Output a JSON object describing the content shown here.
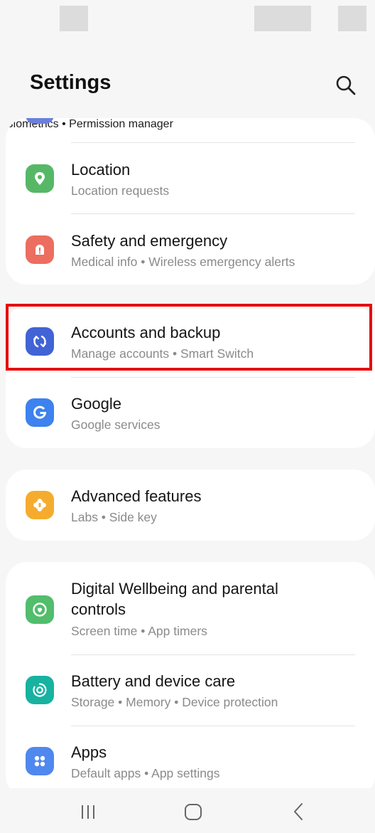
{
  "header": {
    "title": "Settings"
  },
  "items": [
    {
      "title": "Location",
      "subtitle": "Location requests",
      "icon": "location-pin-icon",
      "color": "#56b866"
    },
    {
      "title": "Safety and emergency",
      "subtitle": "Medical info  •  Wireless emergency alerts",
      "icon": "alert-icon",
      "color": "#ec6e60"
    },
    {
      "title": "Accounts and backup",
      "subtitle": "Manage accounts  •  Smart Switch",
      "icon": "sync-icon",
      "color": "#4263d6"
    },
    {
      "title": "Google",
      "subtitle": "Google services",
      "icon": "google-icon",
      "color": "#3d82ee"
    },
    {
      "title": "Advanced features",
      "subtitle": "Labs  •  Side key",
      "icon": "puzzle-icon",
      "color": "#f5ac2e"
    },
    {
      "title_line1": "Digital Wellbeing and parental",
      "title_line2": "controls",
      "subtitle": "Screen time  •  App timers",
      "icon": "wellbeing-icon",
      "color": "#52bd6c"
    },
    {
      "title": "Battery and device care",
      "subtitle": "Storage  •  Memory  •  Device protection",
      "icon": "device-care-icon",
      "color": "#17b2a0"
    },
    {
      "title": "Apps",
      "subtitle": "Default apps  •  App settings",
      "icon": "apps-icon",
      "color": "#4f88ee"
    }
  ],
  "partial_item": {
    "subtitle": "Biometrics  •  Permission manager"
  }
}
